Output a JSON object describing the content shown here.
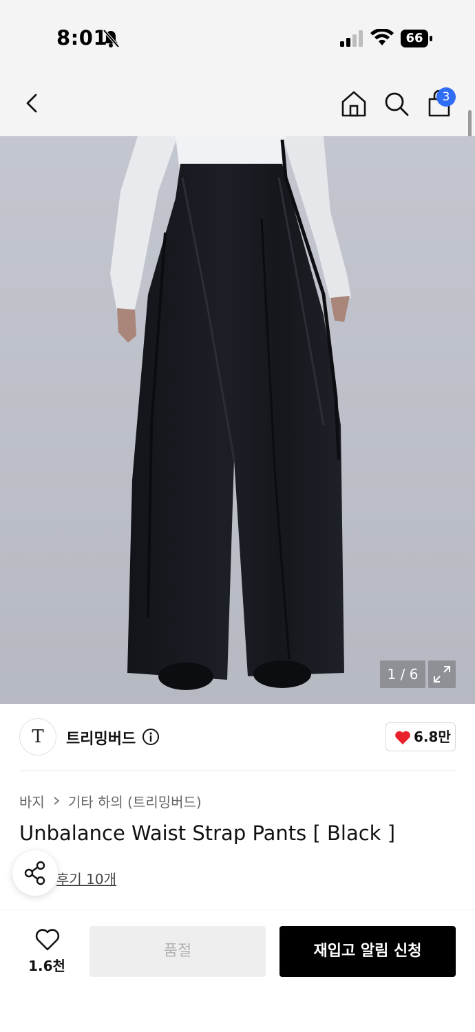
{
  "status_bar": {
    "time": "8:01",
    "battery": "66",
    "icons": [
      "bell-slash-icon",
      "signal-icon",
      "wifi-icon",
      "battery-icon"
    ]
  },
  "header": {
    "icons": [
      "back-arrow-icon",
      "home-icon",
      "search-icon",
      "shopping-bag-icon"
    ],
    "cart_count": "3"
  },
  "gallery": {
    "counter": "1 / 6",
    "expand_icon": "expand-icon"
  },
  "brand": {
    "logo_text": "T",
    "name": "트리밍버드",
    "info_icon": "info-icon",
    "likes": "6.8만",
    "like_color": "#e8202a"
  },
  "product": {
    "breadcrumb": [
      "바지",
      "기타 하의 (트리밍버드)"
    ],
    "title": "Unbalance Waist Strap Pants [ Black ]",
    "review_link": "후기 10개"
  },
  "bottom_bar": {
    "wish_count": "1.6천",
    "soldout_label": "품절",
    "restock_label": "재입고 알림 신청"
  },
  "colors": {
    "accent_badge": "#2f6df5",
    "primary_button": "#000000",
    "disabled_button": "#eeeeee"
  }
}
